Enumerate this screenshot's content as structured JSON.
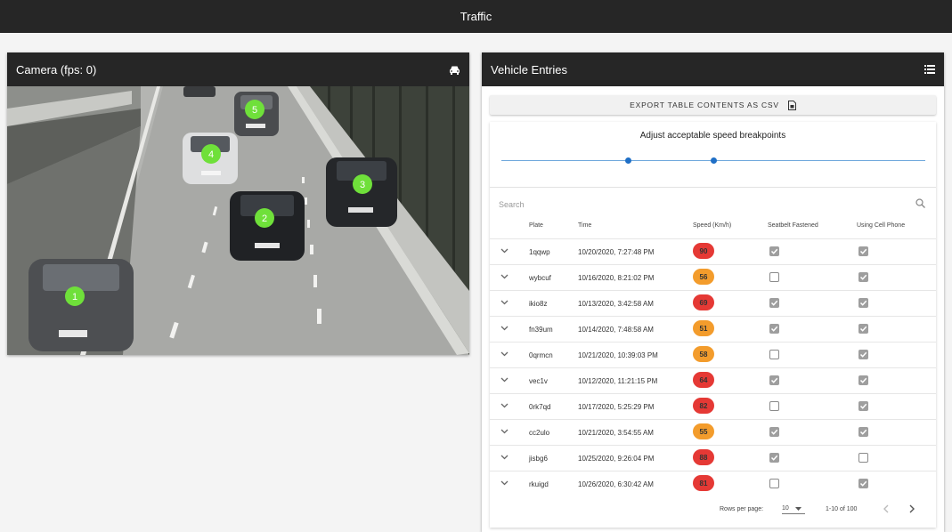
{
  "app": {
    "title": "Traffic"
  },
  "camera": {
    "title": "Camera (fps: 0)",
    "icon": "car-icon",
    "detections": [
      "1",
      "2",
      "3",
      "4",
      "5"
    ],
    "detection_color": "#6fe03a"
  },
  "vehicles": {
    "title": "Vehicle Entries",
    "menu_icon": "menu-icon",
    "export_label": "EXPORT TABLE CONTENTS AS CSV",
    "export_icon": "csv-file-icon",
    "breakpoints_title": "Adjust acceptable speed breakpoints",
    "slider_low_fraction": 0.3,
    "slider_high_fraction": 0.5,
    "accent_color": "#1f6fc6",
    "search_placeholder": "Search",
    "columns": {
      "plate": "Plate",
      "time": "Time",
      "speed": "Speed (Km/h)",
      "seatbelt": "Seatbelt Fastened",
      "phone": "Using Cell Phone"
    },
    "rows": [
      {
        "plate": "1qqwp",
        "time": "10/20/2020, 7:27:48 PM",
        "speed": "90",
        "level": "high",
        "seatbelt": true,
        "phone": true
      },
      {
        "plate": "wybcuf",
        "time": "10/16/2020, 8:21:02 PM",
        "speed": "56",
        "level": "mid",
        "seatbelt": false,
        "phone": true
      },
      {
        "plate": "ikio8z",
        "time": "10/13/2020, 3:42:58 AM",
        "speed": "69",
        "level": "high",
        "seatbelt": true,
        "phone": true
      },
      {
        "plate": "fn39um",
        "time": "10/14/2020, 7:48:58 AM",
        "speed": "51",
        "level": "mid",
        "seatbelt": true,
        "phone": true
      },
      {
        "plate": "0qrmcn",
        "time": "10/21/2020, 10:39:03 PM",
        "speed": "58",
        "level": "mid",
        "seatbelt": false,
        "phone": true
      },
      {
        "plate": "vec1v",
        "time": "10/12/2020, 11:21:15 PM",
        "speed": "64",
        "level": "high",
        "seatbelt": true,
        "phone": true
      },
      {
        "plate": "0rk7qd",
        "time": "10/17/2020, 5:25:29 PM",
        "speed": "82",
        "level": "high",
        "seatbelt": false,
        "phone": true
      },
      {
        "plate": "cc2ulo",
        "time": "10/21/2020, 3:54:55 AM",
        "speed": "55",
        "level": "mid",
        "seatbelt": true,
        "phone": true
      },
      {
        "plate": "jisbg6",
        "time": "10/25/2020, 9:26:04 PM",
        "speed": "88",
        "level": "high",
        "seatbelt": true,
        "phone": false
      },
      {
        "plate": "rkuigd",
        "time": "10/26/2020, 6:30:42 AM",
        "speed": "81",
        "level": "high",
        "seatbelt": false,
        "phone": true
      }
    ],
    "speed_colors": {
      "high": "#e53935",
      "mid": "#f39c2c"
    },
    "footer": {
      "rows_per_page_label": "Rows per page:",
      "rows_per_page_value": "10",
      "range": "1-10 of 100"
    }
  }
}
